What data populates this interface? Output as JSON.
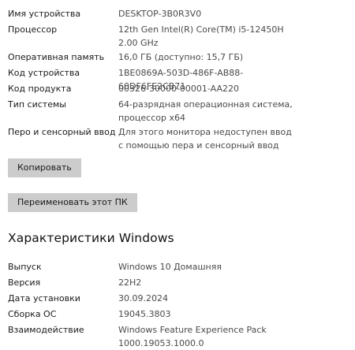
{
  "device_specs": {
    "rows": [
      {
        "label": "Имя устройства",
        "value": "DESKTOP-3B0R3V0"
      },
      {
        "label": "Процессор",
        "value": "12th Gen Intel(R) Core(TM) i5-12450H   2.00 GHz"
      },
      {
        "label": "Оперативная память",
        "value": "16,0 ГБ (доступно: 15,7 ГБ)"
      },
      {
        "label": "Код устройства",
        "value": "1BE0869A-503D-486F-AB88-60DF6FE2CB71"
      },
      {
        "label": "Код продукта",
        "value": "00326-30000-00001-AA220"
      },
      {
        "label": "Тип системы",
        "value": "64-разрядная операционная система, процессор x64"
      },
      {
        "label": "Перо и сенсорный ввод",
        "value": "Для этого монитора недоступен ввод с помощью пера и сенсорный ввод"
      }
    ],
    "copy_button": "Копировать",
    "rename_button": "Переименовать этот ПК"
  },
  "windows_specs": {
    "title": "Характеристики Windows",
    "rows": [
      {
        "label": "Выпуск",
        "value": "Windows 10 Домашняя"
      },
      {
        "label": "Версия",
        "value": "22H2"
      },
      {
        "label": "Дата установки",
        "value": "30.09.2024"
      },
      {
        "label": "Сборка ОС",
        "value": "19045.3803"
      },
      {
        "label": "Взаимодействие",
        "value": "Windows Feature Experience Pack 1000.19053.1000.0"
      }
    ]
  }
}
